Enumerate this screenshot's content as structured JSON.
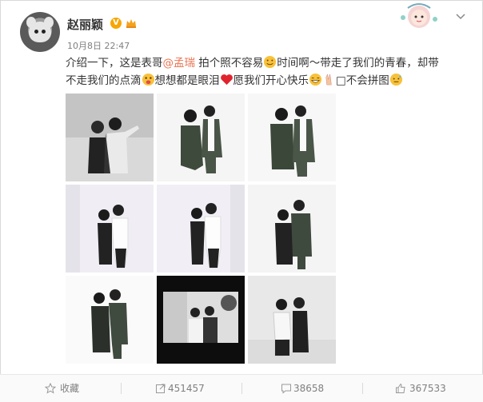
{
  "user": {
    "name": "赵丽颖",
    "time": "10月8日 22:47"
  },
  "post": {
    "segments": [
      {
        "text": "介绍一下，这是表哥",
        "type": "text"
      },
      {
        "text": "@孟瑞",
        "type": "mention"
      },
      {
        "text": "拍个照不容易",
        "type": "text"
      },
      {
        "icon": "smile-emoji",
        "type": "emoji"
      },
      {
        "text": "时间啊～带走了我们的青春，却带不走我们的点滴",
        "type": "text"
      },
      {
        "icon": "tongue-emoji",
        "type": "emoji"
      },
      {
        "text": "想想都是眼泪",
        "type": "text"
      },
      {
        "icon": "heart-emoji",
        "type": "emoji"
      },
      {
        "text": "愿我们开心快乐",
        "type": "text"
      },
      {
        "icon": "grin-emoji",
        "type": "emoji"
      },
      {
        "icon": "victory-emoji",
        "type": "emoji"
      },
      {
        "text": "□不会拼图",
        "type": "text"
      },
      {
        "icon": "sweat-emoji",
        "type": "emoji"
      }
    ],
    "photos": [
      {
        "index": 1,
        "style": "studio-bw"
      },
      {
        "index": 2,
        "style": "white-studio"
      },
      {
        "index": 3,
        "style": "white-studio"
      },
      {
        "index": 4,
        "style": "white-studio"
      },
      {
        "index": 5,
        "style": "white-studio"
      },
      {
        "index": 6,
        "style": "white-studio"
      },
      {
        "index": 7,
        "style": "white-studio"
      },
      {
        "index": 8,
        "style": "dark-screen"
      },
      {
        "index": 9,
        "style": "gray-studio"
      }
    ]
  },
  "actions": {
    "favorite": "收藏",
    "repost": "451457",
    "comment": "38658",
    "like": "367533"
  },
  "colors": {
    "mention": "#eb7350",
    "badge": "#f7a600",
    "muted": "#808080"
  }
}
